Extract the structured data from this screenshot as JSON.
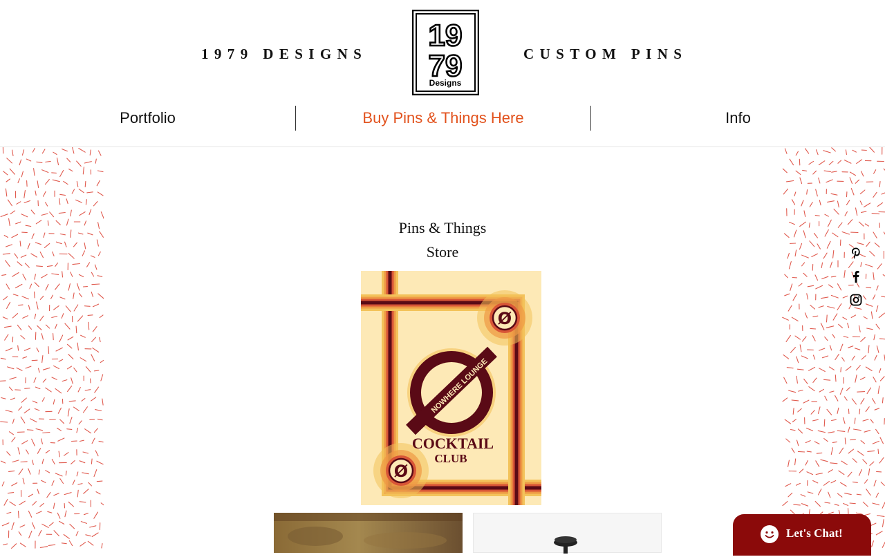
{
  "header": {
    "brand_left": "1979 DESIGNS",
    "brand_right": "CUSTOM PINS",
    "logo": {
      "line1": "19",
      "line2": "79",
      "sub": "Designs"
    }
  },
  "nav": {
    "items": [
      {
        "label": "Portfolio",
        "active": false
      },
      {
        "label": "Buy Pins & Things Here",
        "active": true
      },
      {
        "label": "Info",
        "active": false
      }
    ],
    "active_color": "#e2521d"
  },
  "store": {
    "title_line1": "Pins & Things",
    "title_line2": "Store"
  },
  "poster": {
    "brand_text": "NOWHERE LOUNGE",
    "title_line1": "COCKTAIL",
    "title_line2": "CLUB",
    "symbol": "Ø"
  },
  "social": {
    "icons": [
      "pinterest-icon",
      "facebook-icon",
      "instagram-icon"
    ]
  },
  "chat": {
    "label": "Let's Chat!",
    "color": "#8b0a0a"
  },
  "colors": {
    "pattern": "#e05a4e",
    "poster_bg": "#fde9b6",
    "poster_dark": "#5a0a16"
  }
}
